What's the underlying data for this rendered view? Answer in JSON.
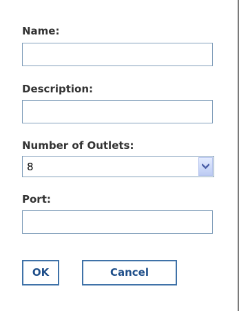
{
  "form": {
    "name": {
      "label": "Name:",
      "value": ""
    },
    "description": {
      "label": "Description:",
      "value": ""
    },
    "outlets": {
      "label": "Number of Outlets:",
      "selected": "8"
    },
    "port": {
      "label": "Port:",
      "value": ""
    }
  },
  "buttons": {
    "ok": "OK",
    "cancel": "Cancel"
  },
  "icons": {
    "dropdown": "chevron-down-icon"
  },
  "colors": {
    "border": "#7f9db9",
    "button_border": "#3f72a8",
    "button_text": "#1f4f8a",
    "dropdown_arrow": "#4d61a8"
  }
}
